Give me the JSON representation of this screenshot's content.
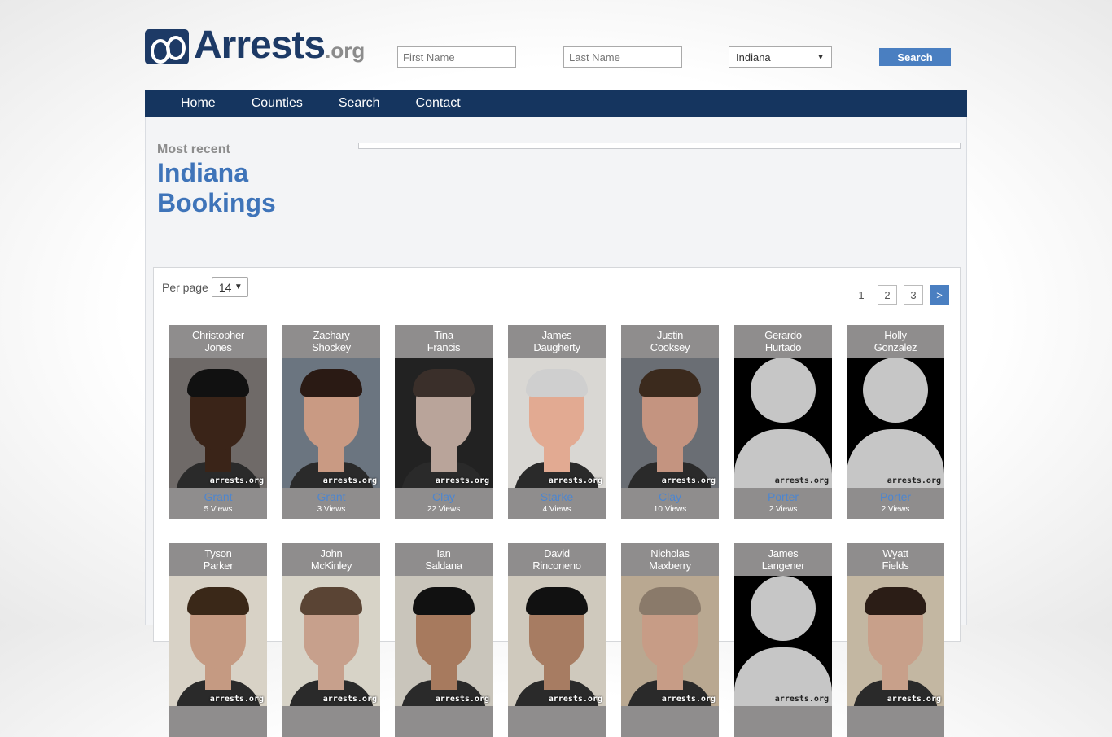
{
  "header": {
    "logo_main": "Arrests",
    "logo_suffix": ".org",
    "first_name_placeholder": "First Name",
    "last_name_placeholder": "Last Name",
    "state_selected": "Indiana",
    "search_label": "Search"
  },
  "nav": [
    "Home",
    "Counties",
    "Search",
    "Contact"
  ],
  "hero": {
    "subtitle": "Most recent",
    "title_line1": "Indiana",
    "title_line2": "Bookings"
  },
  "controls": {
    "per_page_label": "Per page",
    "per_page_value": "14",
    "pages": [
      "1",
      "2",
      "3"
    ],
    "next_label": ">"
  },
  "watermark": "arrests.org",
  "colors": {
    "nav_bg": "#15355f",
    "accent": "#4a7fc1",
    "title": "#3f74b9",
    "card_bg": "#8f8d8d"
  },
  "bookings": [
    {
      "first": "Christopher",
      "last": "Jones",
      "county": "Grant",
      "views": "5 Views",
      "photo": "photo",
      "skin": "#3a2418",
      "bg": "#6f6a68",
      "hair": "#111"
    },
    {
      "first": "Zachary",
      "last": "Shockey",
      "county": "Grant",
      "views": "3 Views",
      "photo": "photo",
      "skin": "#c99a83",
      "bg": "#6b7580",
      "hair": "#2a1a14"
    },
    {
      "first": "Tina",
      "last": "Francis",
      "county": "Clay",
      "views": "22 Views",
      "photo": "photo",
      "skin": "#b9a49a",
      "bg": "#222222",
      "hair": "#3a2f2a"
    },
    {
      "first": "James",
      "last": "Daugherty",
      "county": "Starke",
      "views": "4 Views",
      "photo": "photo",
      "skin": "#e2aa92",
      "bg": "#d9d7d3",
      "hair": "#cfcfcf"
    },
    {
      "first": "Justin",
      "last": "Cooksey",
      "county": "Clay",
      "views": "10 Views",
      "photo": "photo",
      "skin": "#c49480",
      "bg": "#6a6e74",
      "hair": "#3b2a1d"
    },
    {
      "first": "Gerardo",
      "last": "Hurtado",
      "county": "Porter",
      "views": "2 Views",
      "photo": "placeholder"
    },
    {
      "first": "Holly",
      "last": "Gonzalez",
      "county": "Porter",
      "views": "2 Views",
      "photo": "placeholder"
    },
    {
      "first": "Tyson",
      "last": "Parker",
      "county": "",
      "views": "",
      "photo": "photo",
      "skin": "#c59a82",
      "bg": "#d8d2c6",
      "hair": "#3a2818"
    },
    {
      "first": "John",
      "last": "McKinley",
      "county": "",
      "views": "",
      "photo": "photo",
      "skin": "#c7a08c",
      "bg": "#d7d3c7",
      "hair": "#5a4434"
    },
    {
      "first": "Ian",
      "last": "Saldana",
      "county": "",
      "views": "",
      "photo": "photo",
      "skin": "#a77a5e",
      "bg": "#c9c5bb",
      "hair": "#111"
    },
    {
      "first": "David",
      "last": "Rinconeno",
      "county": "",
      "views": "",
      "photo": "photo",
      "skin": "#a77c62",
      "bg": "#cfc9bd",
      "hair": "#111"
    },
    {
      "first": "Nicholas",
      "last": "Maxberry",
      "county": "",
      "views": "",
      "photo": "photo",
      "skin": "#c79c86",
      "bg": "#b9a891",
      "hair": "#8a7a6a"
    },
    {
      "first": "James",
      "last": "Langener",
      "county": "",
      "views": "",
      "photo": "placeholder"
    },
    {
      "first": "Wyatt",
      "last": "Fields",
      "county": "",
      "views": "",
      "photo": "photo",
      "skin": "#c8a08a",
      "bg": "#c3b7a2",
      "hair": "#2b1d16"
    }
  ]
}
